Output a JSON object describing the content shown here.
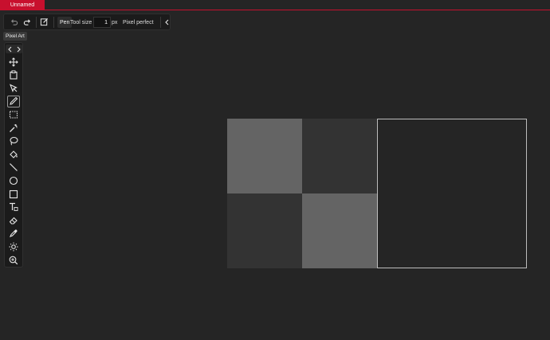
{
  "tabs": [
    {
      "label": "Unnamed",
      "active": true
    }
  ],
  "toolbar": {
    "undo_icon": "undo-icon",
    "redo_icon": "redo-icon",
    "edit_icon": "edit-icon",
    "tool_name": "Pen",
    "tool_size_label": "Tool size",
    "tool_size_value": "1",
    "tool_size_unit": "px",
    "pixel_perfect_label": "Pixel perfect",
    "collapse_icon": "chevron-left-icon"
  },
  "tooltip": "Pixel Art",
  "toolbox": {
    "nav": [
      "chevron-left-icon",
      "chevron-right-icon"
    ],
    "tools": [
      {
        "name": "move-tool",
        "icon": "move-icon"
      },
      {
        "name": "layer-tool",
        "icon": "clipboard-icon"
      },
      {
        "name": "select-tool",
        "icon": "cursor-icon"
      },
      {
        "name": "pen-tool",
        "icon": "pencil-icon",
        "active": true
      },
      {
        "name": "rect-select-tool",
        "icon": "rect-select-icon"
      },
      {
        "name": "magic-wand-tool",
        "icon": "magic-wand-icon"
      },
      {
        "name": "lasso-tool",
        "icon": "lasso-icon"
      },
      {
        "name": "fill-tool",
        "icon": "bucket-icon"
      },
      {
        "name": "line-tool",
        "icon": "line-icon"
      },
      {
        "name": "ellipse-tool",
        "icon": "circle-icon"
      },
      {
        "name": "rectangle-tool",
        "icon": "square-icon"
      },
      {
        "name": "text-tool",
        "icon": "text-icon"
      },
      {
        "name": "eraser-tool",
        "icon": "eraser-icon"
      },
      {
        "name": "eyedropper-tool",
        "icon": "eyedropper-icon"
      },
      {
        "name": "brightness-tool",
        "icon": "sun-icon"
      },
      {
        "name": "zoom-tool",
        "icon": "zoom-in-icon"
      }
    ]
  },
  "colors": {
    "accent": "#c8102e",
    "checker_light": "#646464",
    "checker_dark": "#333333",
    "canvas_border": "#bdbdbd"
  }
}
